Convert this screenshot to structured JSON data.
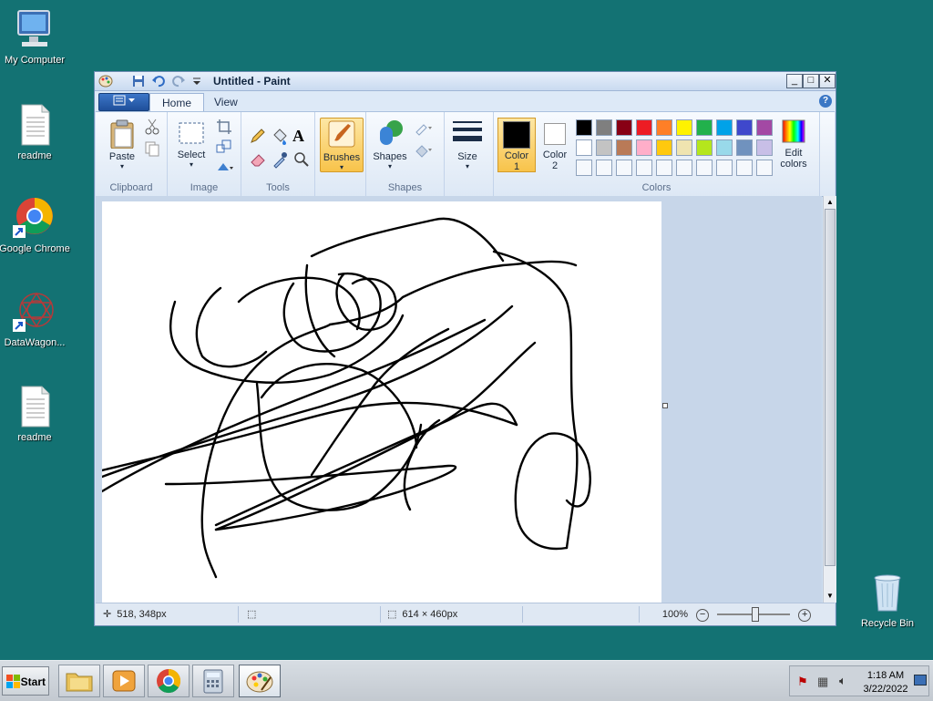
{
  "desktop": {
    "icons": [
      {
        "label": "My Computer"
      },
      {
        "label": "readme"
      },
      {
        "label": "Google Chrome"
      },
      {
        "label": "DataWagon..."
      },
      {
        "label": "readme"
      },
      {
        "label": "Recycle Bin"
      }
    ],
    "background_color": "#137273"
  },
  "window": {
    "title": "Untitled - Paint",
    "controls": {
      "minimize": "_",
      "maximize": "□",
      "close": "✕"
    },
    "tabs": [
      {
        "label": "Home",
        "active": true
      },
      {
        "label": "View",
        "active": false
      }
    ],
    "help": "?",
    "ribbon": {
      "clipboard": {
        "paste": "Paste",
        "group": "Clipboard"
      },
      "image": {
        "select": "Select",
        "group": "Image"
      },
      "tools": {
        "group": "Tools",
        "text_tool": "A"
      },
      "brushes": {
        "label": "Brushes"
      },
      "shapes": {
        "label": "Shapes",
        "group": "Shapes"
      },
      "size": {
        "label": "Size"
      },
      "color1": {
        "label_line1": "Color",
        "label_line2": "1",
        "value": "#000000"
      },
      "color2": {
        "label_line1": "Color",
        "label_line2": "2",
        "value": "#ffffff"
      },
      "colors": {
        "group": "Colors",
        "row1": [
          "#000000",
          "#7f7f7f",
          "#880015",
          "#ed1c24",
          "#ff7f27",
          "#fff200",
          "#22b14c",
          "#00a2e8",
          "#3f48cc",
          "#a349a4"
        ],
        "row2": [
          "#ffffff",
          "#c3c3c3",
          "#b97a57",
          "#ffaec9",
          "#ffc90e",
          "#efe4b0",
          "#b5e61d",
          "#99d9ea",
          "#7092be",
          "#c8bfe7"
        ],
        "row3_count": 10,
        "edit_line1": "Edit",
        "edit_line2": "colors"
      }
    },
    "status": {
      "cursor_pos": "518, 348px",
      "canvas_size": "614 × 460px",
      "zoom": "100%"
    }
  },
  "taskbar": {
    "start": "Start",
    "apps": [
      "file-explorer",
      "media-player",
      "google-chrome",
      "calculator",
      "paint"
    ],
    "clock_time": "1:18 AM",
    "clock_date": "3/22/2022"
  }
}
